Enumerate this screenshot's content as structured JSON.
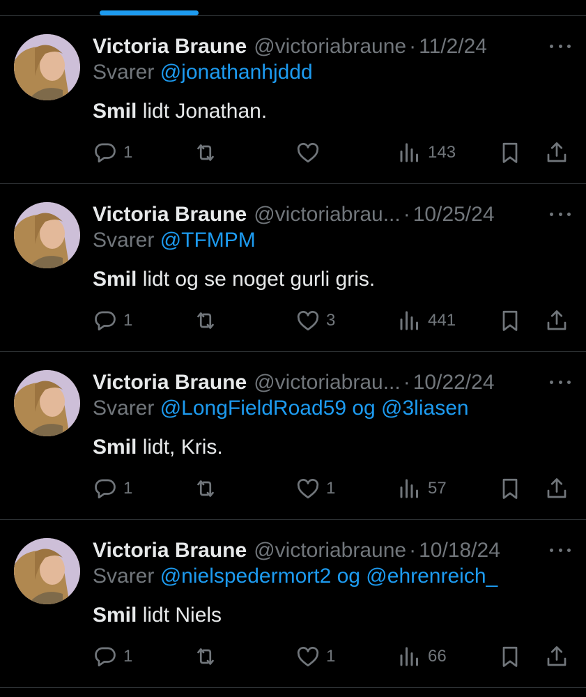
{
  "colors": {
    "accent": "#1d9bf0",
    "muted": "#71767b",
    "text": "#e7e9ea",
    "background": "#000000"
  },
  "tweets": [
    {
      "name": "Victoria Braune",
      "handle": "@victoriabraune",
      "separator": "·",
      "date": "11/2/24",
      "reply_prefix": "Svarer",
      "mentions": "@jonathanhjddd",
      "text_bold": "Smil",
      "text_rest": " lidt Jonathan.",
      "replies": "1",
      "retweets": "",
      "likes": "",
      "views": "143"
    },
    {
      "name": "Victoria Braune",
      "handle": "@victoriabrau...",
      "separator": "·",
      "date": "10/25/24",
      "reply_prefix": "Svarer",
      "mentions": "@TFMPM",
      "text_bold": "Smil",
      "text_rest": " lidt og se noget gurli gris.",
      "replies": "1",
      "retweets": "",
      "likes": "3",
      "views": "441"
    },
    {
      "name": "Victoria Braune",
      "handle": "@victoriabrau...",
      "separator": "·",
      "date": "10/22/24",
      "reply_prefix": "Svarer",
      "mentions": "@LongFieldRoad59 og @3liasen",
      "text_bold": "Smil",
      "text_rest": " lidt, Kris.",
      "replies": "1",
      "retweets": "",
      "likes": "1",
      "views": "57"
    },
    {
      "name": "Victoria Braune",
      "handle": "@victoriabraune",
      "separator": "·",
      "date": "10/18/24",
      "reply_prefix": "Svarer",
      "mentions": "@nielspedermort2 og @ehrenreich_",
      "text_bold": "Smil",
      "text_rest": " lidt Niels",
      "replies": "1",
      "retweets": "",
      "likes": "1",
      "views": "66"
    }
  ],
  "icons": [
    "reply-icon",
    "retweet-icon",
    "like-icon",
    "views-icon",
    "bookmark-icon",
    "share-icon",
    "more-icon"
  ]
}
